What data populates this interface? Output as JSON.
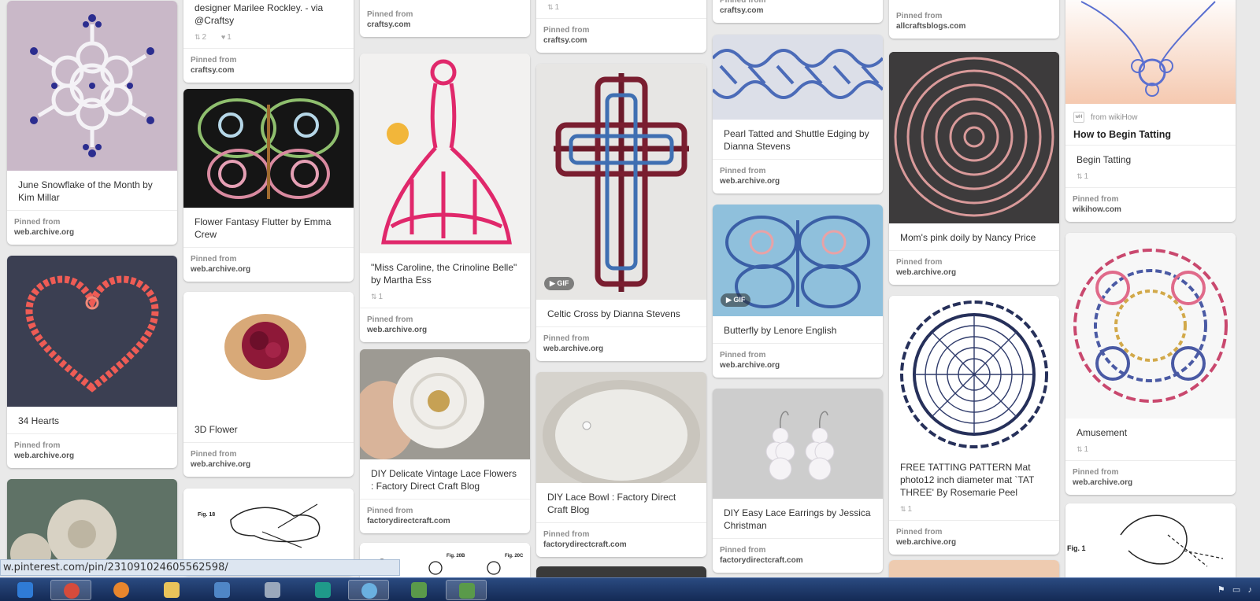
{
  "browser": {
    "status_url": "w.pinterest.com/pin/231091024605562598/"
  },
  "labels": {
    "pinned_from": "Pinned from",
    "gif": "GIF"
  },
  "pins": {
    "c1a": {
      "desc": "June Snowflake of the Month by Kim Millar",
      "domain": "web.archive.org"
    },
    "c1b": {
      "desc": "34 Hearts",
      "domain": "web.archive.org"
    },
    "c2a": {
      "desc": "designer Marilee Rockley. - via @Craftsy",
      "repins": "2",
      "likes": "1",
      "domain": "craftsy.com"
    },
    "c2b": {
      "desc": "Flower Fantasy Flutter by Emma Crew",
      "domain": "web.archive.org"
    },
    "c2c": {
      "desc": "3D Flower",
      "domain": "web.archive.org"
    },
    "c3a": {
      "domain": "craftsy.com"
    },
    "c3b": {
      "desc": "\"Miss Caroline, the Crinoline Belle\" by Martha Ess",
      "repins": "1",
      "domain": "web.archive.org"
    },
    "c3c": {
      "desc": "DIY Delicate Vintage Lace Flowers : Factory Direct Craft Blog",
      "domain": "factorydirectcraft.com"
    },
    "c4a": {
      "repins": "1",
      "domain": "craftsy.com"
    },
    "c4b": {
      "desc": "Celtic Cross by Dianna Stevens",
      "domain": "web.archive.org"
    },
    "c4c": {
      "desc": "DIY Lace Bowl : Factory Direct Craft Blog",
      "domain": "factorydirectcraft.com"
    },
    "c5a": {
      "domain": "craftsy.com"
    },
    "c5b": {
      "desc": "Pearl Tatted and Shuttle Edging by Dianna Stevens",
      "domain": "web.archive.org"
    },
    "c5c": {
      "desc": "Butterfly by Lenore English",
      "domain": "web.archive.org"
    },
    "c5d": {
      "desc": "DIY Easy Lace Earrings by Jessica Christman",
      "domain": "factorydirectcraft.com"
    },
    "c6a": {
      "domain": "allcraftsblogs.com"
    },
    "c6b": {
      "desc": "Mom's pink doily by Nancy Price",
      "domain": "web.archive.org"
    },
    "c6c": {
      "desc": "FREE TATTING PATTERN Mat photo12 inch diameter mat `TAT THREE' By Rosemarie Peel",
      "repins": "1",
      "domain": "web.archive.org"
    },
    "c7a": {
      "rich_source": "from wikiHow",
      "rich_title": "How to Begin Tatting",
      "desc": "Begin Tatting",
      "repins": "1",
      "domain": "wikihow.com"
    },
    "c7b": {
      "desc": "Amusement",
      "repins": "1",
      "domain": "web.archive.org"
    }
  },
  "figure_labels": {
    "fig18": "Fig. 18",
    "fig20b": "Fig. 20B",
    "fig20c": "Fig. 20C",
    "fig1": "Fig. 1"
  },
  "icons": {
    "repin": "repin-icon",
    "like": "heart-icon",
    "gif": "play-icon",
    "wikihow": "wikihow-icon"
  },
  "colors": {
    "background": "#e9e9e9",
    "taskbar": "#1d3664"
  }
}
